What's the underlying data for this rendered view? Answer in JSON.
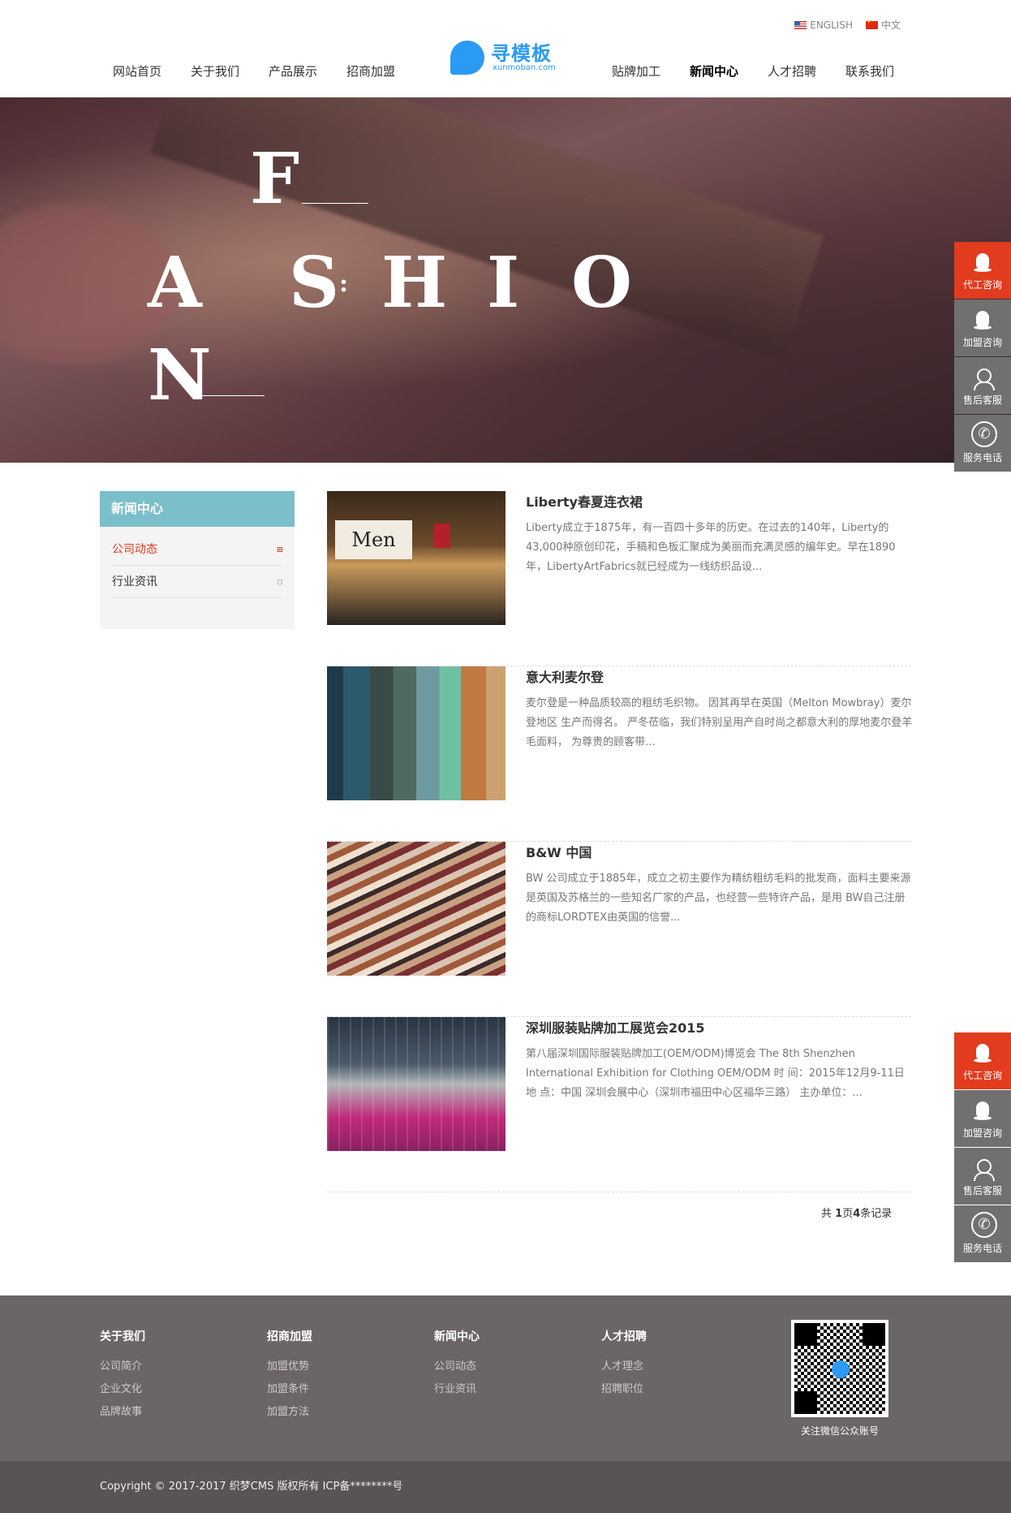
{
  "lang": {
    "english": "ENGLISH",
    "chinese": "中文"
  },
  "nav_left": [
    "网站首页",
    "关于我们",
    "产品展示",
    "招商加盟"
  ],
  "nav_right": [
    "贴牌加工",
    "新闻中心",
    "人才招聘",
    "联系我们"
  ],
  "logo": {
    "cn": "寻模板",
    "en": "xunmoban.com"
  },
  "banner": {
    "letters": [
      "F",
      "A",
      "S",
      "H",
      "I",
      "O",
      "N"
    ]
  },
  "float_buttons": [
    {
      "label": "代工咨询",
      "icon": "qq-icon",
      "color": "#e23b1e"
    },
    {
      "label": "加盟咨询",
      "icon": "qq-icon",
      "color": "#707070"
    },
    {
      "label": "售后客服",
      "icon": "service-icon",
      "color": "#707070"
    },
    {
      "label": "服务电话",
      "icon": "phone-icon",
      "color": "#707070"
    }
  ],
  "sidebar": {
    "title": "新闻中心",
    "items": [
      "公司动态",
      "行业资讯"
    ],
    "active_index": 0,
    "title_color": "#7bbfca"
  },
  "articles": [
    {
      "title": "Liberty春夏连衣裙",
      "desc": "Liberty成立于1875年，有一百四十多年的历史。在过去的140年，Liberty的43,000种原创印花，手稿和色板汇聚成为美丽而充满灵感的编年史。早在1890年，LibertyArtFabrics就已经成为一线纺织品设...",
      "thumb_text": "Men"
    },
    {
      "title": "意大利麦尔登",
      "desc": "麦尔登是一种品质较高的粗纺毛织物。 因其再早在英国（Melton Mowbray）麦尔登地区 生产而得名。 严冬莅临，我们特别呈用产自时尚之都意大利的厚地麦尔登羊毛面料， 为尊贵的顾客带..."
    },
    {
      "title": "B&W 中国",
      "desc": "BW 公司成立于1885年，成立之初主要作为精纺粗纺毛料的批发商，面料主要来源是英国及苏格兰的一些知名厂家的产品，也经营一些特许产品，是用 BW自己注册的商标LORDTEX由英国的信誉..."
    },
    {
      "title": "深圳服装贴牌加工展览会2015",
      "desc": "第八届深圳国际服装贴牌加工(OEM/ODM)博览会 The 8th Shenzhen International Exhibition for Clothing OEM/ODM 时 间：2015年12月9-11日 地 点：中国 深圳会展中心（深圳市福田中心区福华三路） 主办单位：..."
    }
  ],
  "pager": {
    "prefix": "共 ",
    "pages": "1",
    "mid": "页",
    "records": "4",
    "suffix": "条记录"
  },
  "footer": {
    "columns": [
      {
        "title": "关于我们",
        "links": [
          "公司简介",
          "企业文化",
          "品牌故事"
        ]
      },
      {
        "title": "招商加盟",
        "links": [
          "加盟优势",
          "加盟条件",
          "加盟方法"
        ]
      },
      {
        "title": "新闻中心",
        "links": [
          "公司动态",
          "行业资讯"
        ]
      },
      {
        "title": "人才招聘",
        "links": [
          "人才理念",
          "招聘职位"
        ]
      }
    ],
    "qr_label": "关注微信公众账号",
    "copyright": "Copyright © 2017-2017 织梦CMS 版权所有     ICP备********号"
  },
  "colors": {
    "accent_red": "#e23b1e",
    "brand_blue": "#2b9af3",
    "footer_bg": "#6c6565"
  }
}
